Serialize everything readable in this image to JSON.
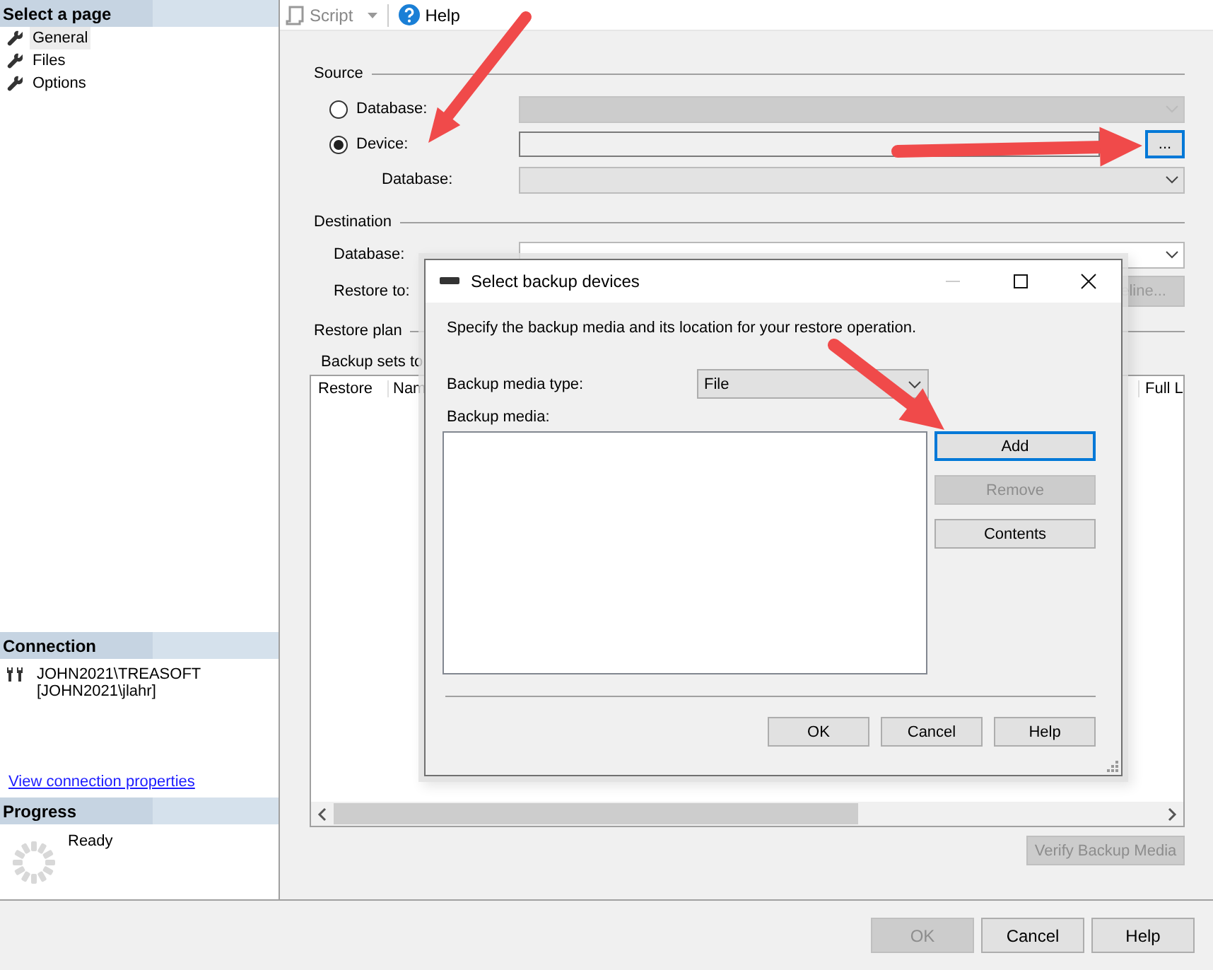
{
  "toolbar": {
    "script": "Script",
    "help": "Help"
  },
  "sidebar": {
    "title": "Select a page",
    "items": [
      {
        "label": "General",
        "selected": true
      },
      {
        "label": "Files",
        "selected": false
      },
      {
        "label": "Options",
        "selected": false
      }
    ]
  },
  "connection": {
    "title": "Connection",
    "server": "JOHN2021\\TREASOFT",
    "user": "[JOHN2021\\jlahr]",
    "link": "View connection properties"
  },
  "progress": {
    "title": "Progress",
    "status": "Ready"
  },
  "source": {
    "title": "Source",
    "options": [
      {
        "label": "Database:",
        "selected": false
      },
      {
        "label": "Device:",
        "selected": true
      }
    ],
    "browse_button": {
      "label": "...",
      "focused": true
    },
    "database_label": "Database:"
  },
  "destination": {
    "title": "Destination",
    "database_label": "Database:",
    "restore_to_label": "Restore to:",
    "timeline_button": {
      "label": "eline...",
      "disabled": true
    }
  },
  "restore_plan": {
    "title": "Restore plan",
    "backup_sets_label": "Backup sets to",
    "columns": [
      "Restore",
      "Nam",
      "Full L"
    ]
  },
  "verify_button": {
    "label": "Verify Backup Media",
    "disabled": true
  },
  "buttons": [
    {
      "label": "OK",
      "disabled": true
    },
    {
      "label": "Cancel",
      "disabled": false
    },
    {
      "label": "Help",
      "disabled": false
    }
  ],
  "dialog": {
    "title": "Select backup devices",
    "description": "Specify the backup media and its location for your restore operation.",
    "media_type_label": "Backup media type:",
    "media_type": "File",
    "media_label": "Backup media:",
    "side_buttons": [
      {
        "label": "Add",
        "disabled": false,
        "focused": true
      },
      {
        "label": "Remove",
        "disabled": true,
        "focused": false
      },
      {
        "label": "Contents",
        "disabled": false,
        "focused": false
      }
    ],
    "buttons": [
      "OK",
      "Cancel",
      "Help"
    ]
  }
}
